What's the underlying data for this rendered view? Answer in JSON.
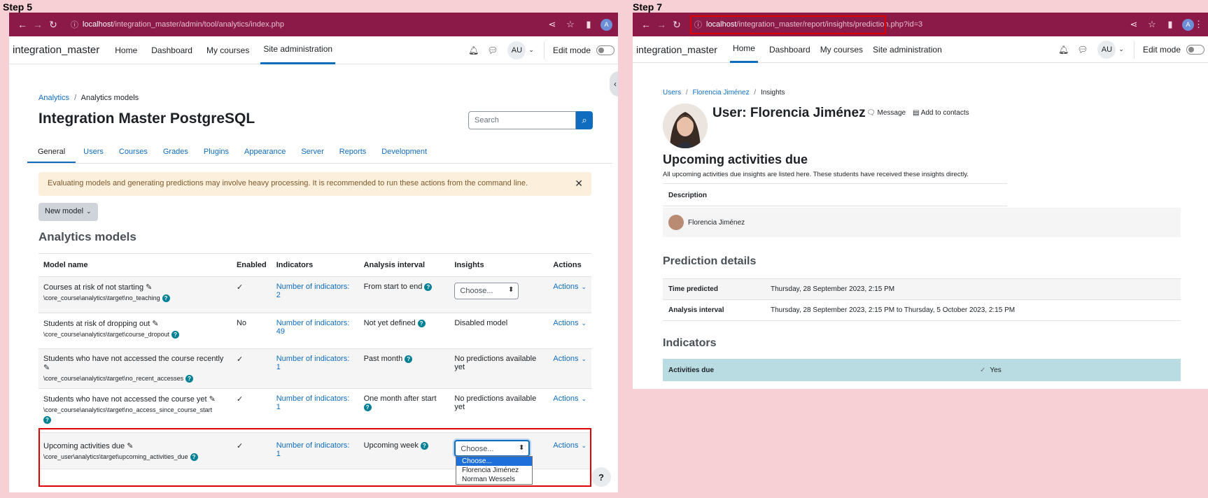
{
  "step5": {
    "label": "Step 5",
    "browser": {
      "url_host": "localhost",
      "url_path": "/integration_master/admin/tool/analytics/index.php",
      "profile_initial": "A"
    },
    "nav": {
      "site_name": "integration_master",
      "links": [
        "Home",
        "Dashboard",
        "My courses",
        "Site administration"
      ],
      "user_initials": "AU",
      "edit_mode": "Edit mode"
    },
    "breadcrumb": [
      "Analytics",
      "Analytics models"
    ],
    "page_title": "Integration Master PostgreSQL",
    "search_placeholder": "Search",
    "tabs": [
      "General",
      "Users",
      "Courses",
      "Grades",
      "Plugins",
      "Appearance",
      "Server",
      "Reports",
      "Development"
    ],
    "alert": "Evaluating models and generating predictions may involve heavy processing. It is recommended to run these actions from the command line.",
    "new_model": "New model",
    "section_title": "Analytics models",
    "table_headers": [
      "Model name",
      "Enabled",
      "Indicators",
      "Analysis interval",
      "Insights",
      "Actions"
    ],
    "rows": [
      {
        "name": "Courses at risk of not starting",
        "target": "\\core_course\\analytics\\target\\no_teaching",
        "enabled": "✓",
        "indicators": "Number of indicators: 2",
        "interval": "From start to end",
        "insights": "Choose...",
        "actions": "Actions"
      },
      {
        "name": "Students at risk of dropping out",
        "target": "\\core_course\\analytics\\target\\course_dropout",
        "enabled": "No",
        "indicators": "Number of indicators: 49",
        "interval": "Not yet defined",
        "insights": "Disabled model",
        "actions": "Actions"
      },
      {
        "name": "Students who have not accessed the course recently",
        "target": "\\core_course\\analytics\\target\\no_recent_accesses",
        "enabled": "✓",
        "indicators": "Number of indicators: 1",
        "interval": "Past month",
        "insights": "No predictions available yet",
        "actions": "Actions"
      },
      {
        "name": "Students who have not accessed the course yet",
        "target": "\\core_course\\analytics\\target\\no_access_since_course_start",
        "enabled": "✓",
        "indicators": "Number of indicators: 1",
        "interval": "One month after start",
        "insights": "No predictions available yet",
        "actions": "Actions"
      },
      {
        "name": "Upcoming activities due",
        "target": "\\core_user\\analytics\\target\\upcoming_activities_due",
        "enabled": "✓",
        "indicators": "Number of indicators: 1",
        "interval": "Upcoming week",
        "insights": "Choose...",
        "actions": "Actions"
      }
    ],
    "dropdown_options": [
      "Choose...",
      "Florencia Jiménez",
      "Norman Wessels"
    ],
    "help_button": "?"
  },
  "step7": {
    "label": "Step 7",
    "browser": {
      "url_host": "localhost",
      "url_path": "/integration_master/report/insights/prediction.php?id=3",
      "profile_initial": "A"
    },
    "nav": {
      "site_name": "integration_master",
      "links": [
        "Home",
        "Dashboard",
        "My courses",
        "Site administration"
      ],
      "user_initials": "AU",
      "edit_mode": "Edit mode"
    },
    "breadcrumb": [
      "Users",
      "Florencia Jiménez",
      "Insights"
    ],
    "user_title": "User: Florencia Jiménez",
    "message": "Message",
    "add_contacts": "Add to contacts",
    "heading": "Upcoming activities due",
    "intro": "All upcoming activities due insights are listed here. These students have received these insights directly.",
    "desc_header": "Description",
    "student": "Florencia Jiménez",
    "prediction_title": "Prediction details",
    "details": [
      {
        "label": "Time predicted",
        "value": "Thursday, 28 September 2023, 2:15 PM"
      },
      {
        "label": "Analysis interval",
        "value": "Thursday, 28 September 2023, 2:15 PM to Thursday, 5 October 2023, 2:15 PM"
      }
    ],
    "indicators_title": "Indicators",
    "indicator": {
      "label": "Activities due",
      "value": "Yes"
    }
  }
}
